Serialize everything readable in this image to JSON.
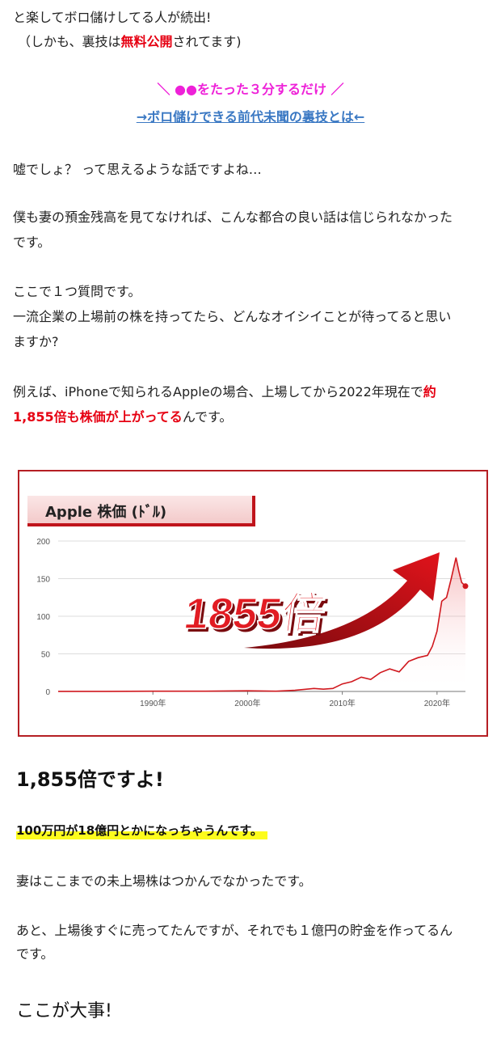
{
  "intro": {
    "line1": "と楽してボロ儲けしてる人が続出!",
    "line2_pre": "（しかも、裏技は",
    "line2_red": "無料公開",
    "line2_post": "されてます)"
  },
  "cta": {
    "tagline": "＼ ●●をたった３分するだけ ／",
    "link_text": "→ボロ儲けできる前代未聞の裏技とは←"
  },
  "paragraphs": {
    "p1": "嘘でしょ？ って思えるような話ですよね…",
    "p2_line1": "僕も妻の預金残高を見てなければ、こんな都合の良い話は信じられなかった",
    "p2_line2": "です。",
    "p3_line1": "ここで１つ質問です。",
    "p3_line2": "一流企業の上場前の株を持ってたら、どんなオイシイことが待ってると思い",
    "p3_line3": "ますか?",
    "p4_line1_pre": "例えば、iPhoneで知られるAppleの場合、上場してから2022年現在で",
    "p4_line1_red": "約",
    "p4_line2_red": "1,855倍も株価が上がってる",
    "p4_line2_post": "んです。"
  },
  "chart_data": {
    "type": "line",
    "title": "Apple 株価 (ﾄﾞﾙ)",
    "annotation": "1855倍",
    "ylabel": "",
    "xlabel": "",
    "ylim": [
      0,
      200
    ],
    "y_ticks": [
      "0",
      "50",
      "100",
      "150",
      "200"
    ],
    "x_ticks": [
      {
        "label": "1990年",
        "x": 1990
      },
      {
        "label": "2000年",
        "x": 2000
      },
      {
        "label": "2010年",
        "x": 2010
      },
      {
        "label": "2020年",
        "x": 2020
      }
    ],
    "xlim": [
      1980,
      2023
    ],
    "grid": true,
    "line_color": "#d0181e",
    "x": [
      1980,
      1985,
      1990,
      1995,
      2000,
      2003,
      2005,
      2007,
      2008,
      2009,
      2010,
      2011,
      2012,
      2013,
      2014,
      2015,
      2016,
      2017,
      2018,
      2019,
      2019.5,
      2020,
      2020.5,
      2021,
      2021.5,
      2022,
      2022.3,
      2022.6,
      2023
    ],
    "y": [
      0.1,
      0.1,
      0.3,
      0.3,
      0.9,
      0.3,
      1.5,
      4,
      3,
      4,
      10,
      13,
      19,
      16,
      25,
      30,
      26,
      40,
      45,
      48,
      60,
      80,
      120,
      125,
      150,
      178,
      160,
      145,
      140
    ]
  },
  "after": {
    "big": "1,855倍ですよ!",
    "highlight": "100万円が18億円とかになっちゃうんです。",
    "p5": "妻はここまでの未上場株はつかんでなかったです。",
    "p6_line1": "あと、上場後すぐに売ってたんですが、それでも１億円の貯金を作ってるん",
    "p6_line2": "です。",
    "last": "ここが大事!"
  },
  "colors": {
    "accent_red": "#e60012",
    "magenta": "#ee21d8",
    "link_blue": "#3a78c3",
    "highlight_yellow": "#fdfc1d",
    "frame_red": "#b51f24"
  }
}
